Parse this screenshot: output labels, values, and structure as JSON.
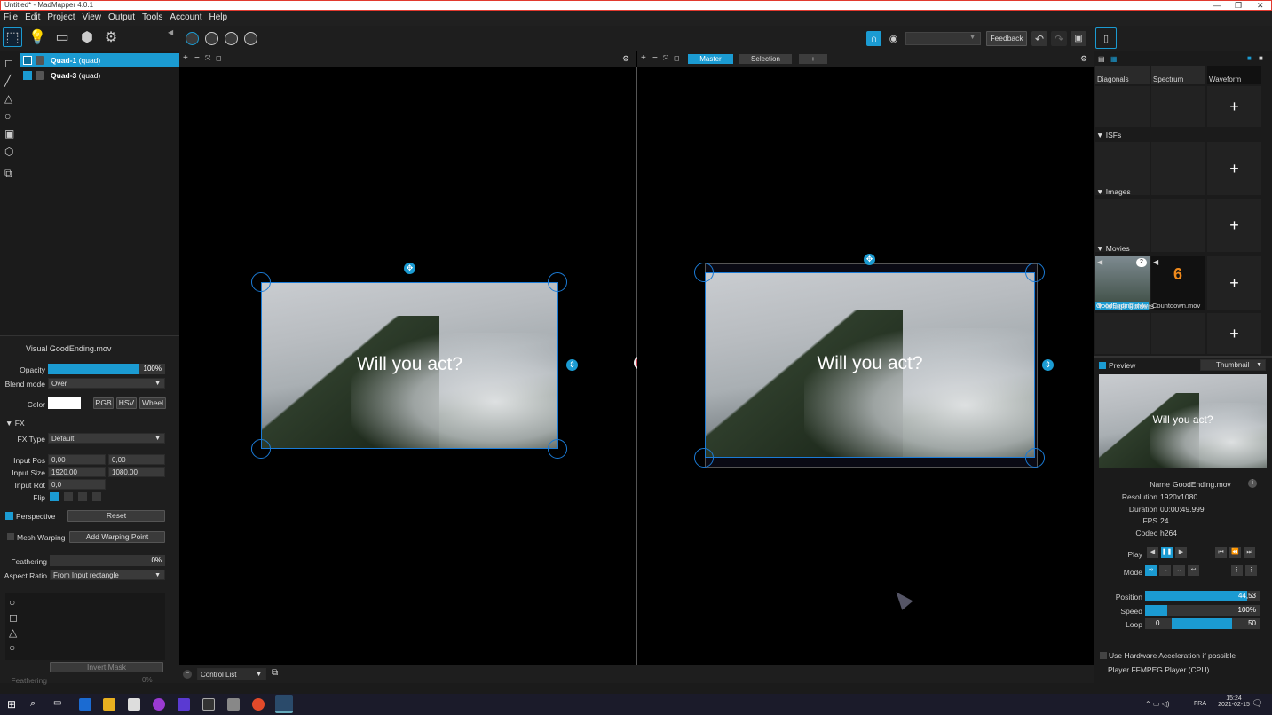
{
  "window": {
    "title": "Untitled* - MadMapper 4.0.1"
  },
  "menu": [
    "File",
    "Edit",
    "Project",
    "View",
    "Output",
    "Tools",
    "Account",
    "Help"
  ],
  "toolbar": {
    "feedback": "Feedback"
  },
  "layers": [
    {
      "name": "Quad-1",
      "type": "(quad)",
      "selected": true
    },
    {
      "name": "Quad-3",
      "type": "(quad)",
      "selected": false
    }
  ],
  "props": {
    "title": "Visual GoodEnding.mov",
    "opacity_label": "Opacity",
    "opacity_value": "100%",
    "opacity_level": 1.0,
    "blend_label": "Blend mode",
    "blend_value": "Over",
    "color_label": "Color",
    "rgb": "RGB",
    "hsv": "HSV",
    "wheel": "Wheel",
    "fx_section": "FX",
    "fx_type_label": "FX Type",
    "fx_type_value": "Default",
    "input_pos_label": "Input Pos",
    "input_pos_x": "0,00",
    "input_pos_y": "0,00",
    "input_size_label": "Input Size",
    "input_size_w": "1920,00",
    "input_size_h": "1080,00",
    "input_rot_label": "Input Rot",
    "input_rot_value": "0,0",
    "flip_label": "Flip",
    "perspective_label": "Perspective",
    "reset": "Reset",
    "mesh_label": "Mesh Warping",
    "add_warp": "Add Warping Point",
    "feathering_label": "Feathering",
    "feathering_value": "0%",
    "feathering_level": 0,
    "aspect_label": "Aspect Ratio",
    "aspect_value": "From Input rectangle",
    "invert_mask": "Invert Mask",
    "feathering2_label": "Feathering",
    "feathering2_value": "0%"
  },
  "viewport": {
    "tabs": [
      "Master",
      "Selection",
      "+"
    ],
    "left_text": "Will you act?",
    "right_text": "Will you act?",
    "control_list": "Control List"
  },
  "library": {
    "generators": [
      "Diagonals",
      "Spectrum",
      "Waveform"
    ],
    "isfs": "ISFs",
    "images": "Images",
    "movies": "Movies",
    "movie_items": [
      {
        "name": "GoodEnding.mov",
        "badge": "2"
      },
      {
        "name": "Countdown.mov",
        "badge": "6"
      }
    ],
    "image_folders": "Image Folders"
  },
  "preview": {
    "label": "Preview",
    "mode": "Thumbnail",
    "text": "Will you act?",
    "name_label": "Name",
    "name_value": "GoodEnding.mov",
    "res_label": "Resolution",
    "res_value": "1920x1080",
    "dur_label": "Duration",
    "dur_value": "00:00:49.999",
    "fps_label": "FPS",
    "fps_value": "24",
    "codec_label": "Codec",
    "codec_value": "h264",
    "play_label": "Play",
    "mode_label": "Mode",
    "position_label": "Position",
    "position_value": "44,53",
    "position_level": 0.89,
    "speed_label": "Speed",
    "speed_value": "100%",
    "speed_level": 0.19,
    "loop_label": "Loop",
    "loop_start": "0",
    "loop_end": "50",
    "hw_accel": "Use Hardware Acceleration if possible",
    "player": "Player FFMPEG Player (CPU)"
  },
  "taskbar": {
    "lang": "FRA",
    "time": "15:24",
    "date": "2021-02-15"
  }
}
